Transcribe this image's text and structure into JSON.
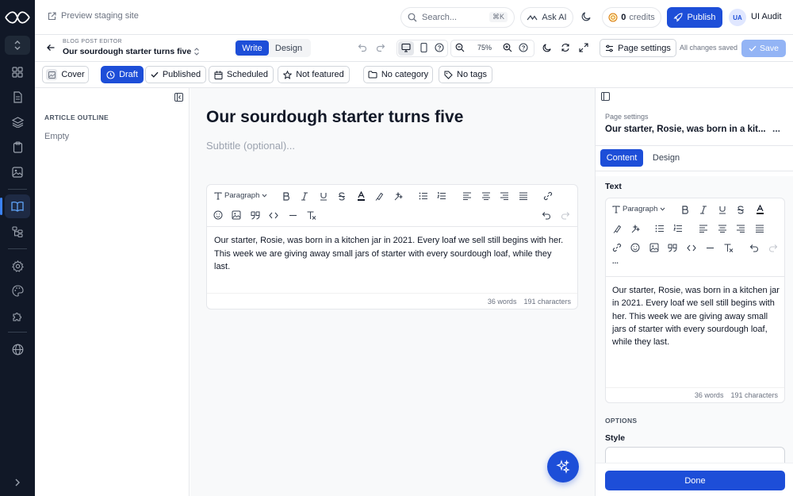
{
  "topbar": {
    "preview_label": "Preview staging site",
    "search_placeholder": "Search...",
    "search_shortcut": "⌘K",
    "ask_ai_label": "Ask AI",
    "credits_count": "0",
    "credits_label": "credits",
    "publish_label": "Publish",
    "user_initials": "UA",
    "user_name": "UI Audit"
  },
  "editor_header": {
    "kicker": "BLOG POST EDITOR",
    "title": "Our sourdough starter turns five",
    "mode_tabs": [
      "Write",
      "Design"
    ],
    "active_mode": "Write",
    "zoom": "75%",
    "page_settings_label": "Page settings",
    "save_status": "All changes saved",
    "save_label": "Save"
  },
  "status_bar": {
    "cover_label": "Cover",
    "draft_label": "Draft",
    "published_label": "Published",
    "scheduled_label": "Scheduled",
    "featured_label": "Not featured",
    "category_label": "No category",
    "tags_label": "No tags"
  },
  "outline": {
    "title": "ARTICLE OUTLINE",
    "empty_text": "Empty"
  },
  "document": {
    "title": "Our sourdough starter turns five",
    "subtitle_placeholder": "Subtitle (optional)...",
    "block_type": "Paragraph",
    "body": "Our starter, Rosie, was born in a kitchen jar in 2021. Every loaf we sell still begins with her. This week we are giving away small jars of starter with every sourdough loaf, while they last.",
    "word_count": "36 words",
    "char_count": "191 characters"
  },
  "settings_panel": {
    "section_label": "Page settings",
    "page_title": "Our starter, Rosie, was born in a kit...",
    "more_label": "...",
    "tabs": [
      "Content",
      "Design"
    ],
    "active_tab": "Content",
    "text_label": "Text",
    "block_type": "Paragraph",
    "more_tools": "...",
    "body": "Our starter, Rosie, was born in a kitchen jar in 2021. Every loaf we sell still begins with her. This week we are giving away small jars of starter with every sourdough loaf, while they last.",
    "word_count": "36 words",
    "char_count": "191 characters",
    "options_label": "OPTIONS",
    "style_label": "Style",
    "done_label": "Done"
  },
  "colors": {
    "accent": "#1d4ed8",
    "rail_bg": "#111827",
    "save_disabled": "#93b4f5"
  },
  "icons": {
    "rail": [
      "logo-icon",
      "workspace-switch-icon",
      "dashboard-icon",
      "pages-icon",
      "layers-icon",
      "clipboard-icon",
      "image-icon",
      "book-icon",
      "sitemap-icon",
      "settings-icon",
      "palette-icon",
      "puzzle-icon",
      "globe-icon",
      "expand-icon"
    ]
  }
}
